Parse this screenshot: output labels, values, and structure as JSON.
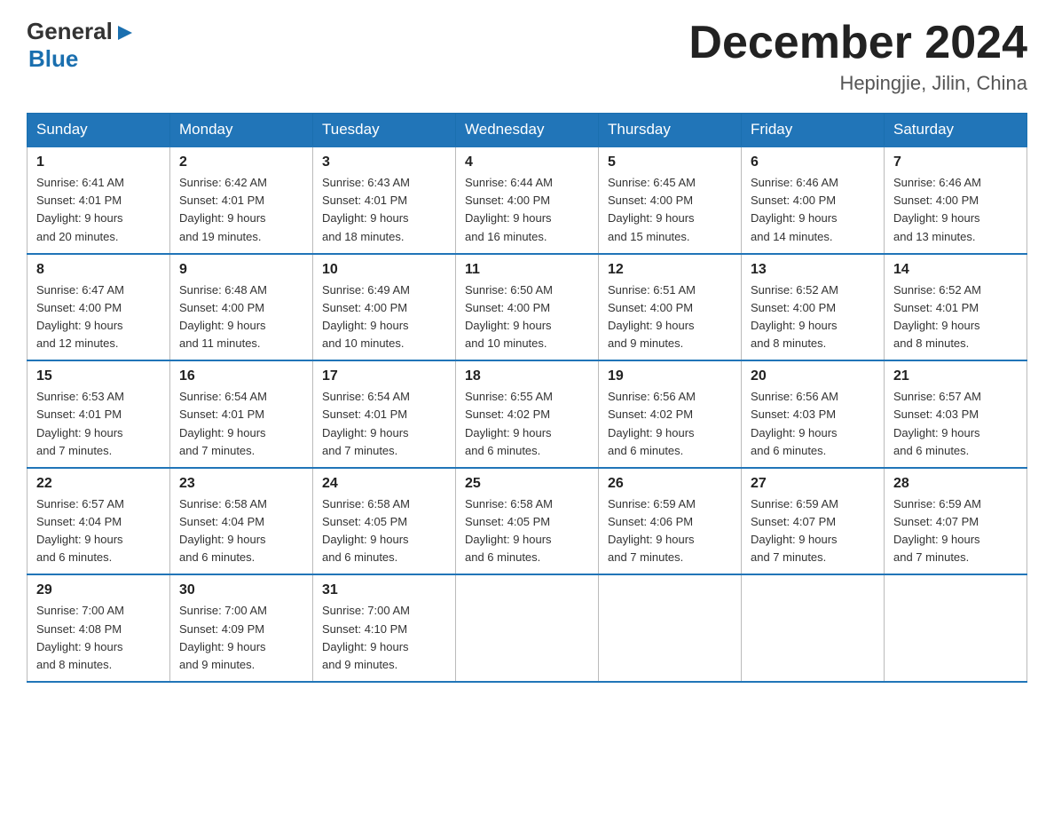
{
  "header": {
    "logo_general": "General",
    "logo_blue": "Blue",
    "month_title": "December 2024",
    "location": "Hepingjie, Jilin, China"
  },
  "days_of_week": [
    "Sunday",
    "Monday",
    "Tuesday",
    "Wednesday",
    "Thursday",
    "Friday",
    "Saturday"
  ],
  "weeks": [
    [
      {
        "day": "1",
        "sunrise": "6:41 AM",
        "sunset": "4:01 PM",
        "daylight": "9 hours and 20 minutes."
      },
      {
        "day": "2",
        "sunrise": "6:42 AM",
        "sunset": "4:01 PM",
        "daylight": "9 hours and 19 minutes."
      },
      {
        "day": "3",
        "sunrise": "6:43 AM",
        "sunset": "4:01 PM",
        "daylight": "9 hours and 18 minutes."
      },
      {
        "day": "4",
        "sunrise": "6:44 AM",
        "sunset": "4:00 PM",
        "daylight": "9 hours and 16 minutes."
      },
      {
        "day": "5",
        "sunrise": "6:45 AM",
        "sunset": "4:00 PM",
        "daylight": "9 hours and 15 minutes."
      },
      {
        "day": "6",
        "sunrise": "6:46 AM",
        "sunset": "4:00 PM",
        "daylight": "9 hours and 14 minutes."
      },
      {
        "day": "7",
        "sunrise": "6:46 AM",
        "sunset": "4:00 PM",
        "daylight": "9 hours and 13 minutes."
      }
    ],
    [
      {
        "day": "8",
        "sunrise": "6:47 AM",
        "sunset": "4:00 PM",
        "daylight": "9 hours and 12 minutes."
      },
      {
        "day": "9",
        "sunrise": "6:48 AM",
        "sunset": "4:00 PM",
        "daylight": "9 hours and 11 minutes."
      },
      {
        "day": "10",
        "sunrise": "6:49 AM",
        "sunset": "4:00 PM",
        "daylight": "9 hours and 10 minutes."
      },
      {
        "day": "11",
        "sunrise": "6:50 AM",
        "sunset": "4:00 PM",
        "daylight": "9 hours and 10 minutes."
      },
      {
        "day": "12",
        "sunrise": "6:51 AM",
        "sunset": "4:00 PM",
        "daylight": "9 hours and 9 minutes."
      },
      {
        "day": "13",
        "sunrise": "6:52 AM",
        "sunset": "4:00 PM",
        "daylight": "9 hours and 8 minutes."
      },
      {
        "day": "14",
        "sunrise": "6:52 AM",
        "sunset": "4:01 PM",
        "daylight": "9 hours and 8 minutes."
      }
    ],
    [
      {
        "day": "15",
        "sunrise": "6:53 AM",
        "sunset": "4:01 PM",
        "daylight": "9 hours and 7 minutes."
      },
      {
        "day": "16",
        "sunrise": "6:54 AM",
        "sunset": "4:01 PM",
        "daylight": "9 hours and 7 minutes."
      },
      {
        "day": "17",
        "sunrise": "6:54 AM",
        "sunset": "4:01 PM",
        "daylight": "9 hours and 7 minutes."
      },
      {
        "day": "18",
        "sunrise": "6:55 AM",
        "sunset": "4:02 PM",
        "daylight": "9 hours and 6 minutes."
      },
      {
        "day": "19",
        "sunrise": "6:56 AM",
        "sunset": "4:02 PM",
        "daylight": "9 hours and 6 minutes."
      },
      {
        "day": "20",
        "sunrise": "6:56 AM",
        "sunset": "4:03 PM",
        "daylight": "9 hours and 6 minutes."
      },
      {
        "day": "21",
        "sunrise": "6:57 AM",
        "sunset": "4:03 PM",
        "daylight": "9 hours and 6 minutes."
      }
    ],
    [
      {
        "day": "22",
        "sunrise": "6:57 AM",
        "sunset": "4:04 PM",
        "daylight": "9 hours and 6 minutes."
      },
      {
        "day": "23",
        "sunrise": "6:58 AM",
        "sunset": "4:04 PM",
        "daylight": "9 hours and 6 minutes."
      },
      {
        "day": "24",
        "sunrise": "6:58 AM",
        "sunset": "4:05 PM",
        "daylight": "9 hours and 6 minutes."
      },
      {
        "day": "25",
        "sunrise": "6:58 AM",
        "sunset": "4:05 PM",
        "daylight": "9 hours and 6 minutes."
      },
      {
        "day": "26",
        "sunrise": "6:59 AM",
        "sunset": "4:06 PM",
        "daylight": "9 hours and 7 minutes."
      },
      {
        "day": "27",
        "sunrise": "6:59 AM",
        "sunset": "4:07 PM",
        "daylight": "9 hours and 7 minutes."
      },
      {
        "day": "28",
        "sunrise": "6:59 AM",
        "sunset": "4:07 PM",
        "daylight": "9 hours and 7 minutes."
      }
    ],
    [
      {
        "day": "29",
        "sunrise": "7:00 AM",
        "sunset": "4:08 PM",
        "daylight": "9 hours and 8 minutes."
      },
      {
        "day": "30",
        "sunrise": "7:00 AM",
        "sunset": "4:09 PM",
        "daylight": "9 hours and 9 minutes."
      },
      {
        "day": "31",
        "sunrise": "7:00 AM",
        "sunset": "4:10 PM",
        "daylight": "9 hours and 9 minutes."
      },
      null,
      null,
      null,
      null
    ]
  ],
  "labels": {
    "sunrise": "Sunrise:",
    "sunset": "Sunset:",
    "daylight": "Daylight:"
  }
}
